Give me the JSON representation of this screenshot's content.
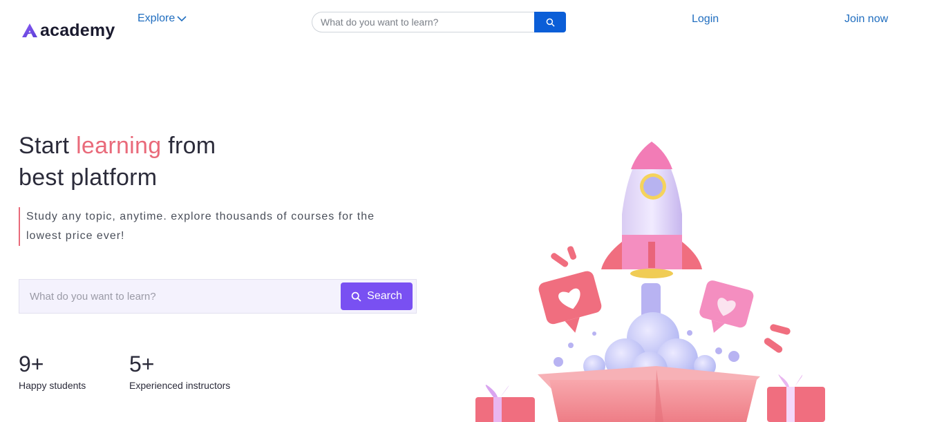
{
  "header": {
    "logo_text": "academy",
    "explore_label": "Explore",
    "search_placeholder": "What do you want to learn?",
    "login_label": "Login",
    "join_label": "Join now"
  },
  "hero": {
    "title_part1": "Start ",
    "title_accent": "learning",
    "title_part2": " from",
    "title_line2": "best platform",
    "subtitle": "Study any topic, anytime. explore thousands of courses for the lowest price ever!",
    "search_placeholder": "What do you want to learn?",
    "search_button_label": "Search"
  },
  "stats": [
    {
      "value": "9+",
      "label": "Happy students"
    },
    {
      "value": "5+",
      "label": "Experienced instructors"
    }
  ],
  "colors": {
    "accent": "#e96a7a",
    "primary_blue": "#0b5ed7",
    "link_blue": "#1f6dbf",
    "purple": "#7950f2"
  },
  "icons": {
    "logo": "academy-logo-icon",
    "explore_chevron": "chevron-down-icon",
    "search": "search-icon",
    "illustration": "rocket-illustration"
  }
}
